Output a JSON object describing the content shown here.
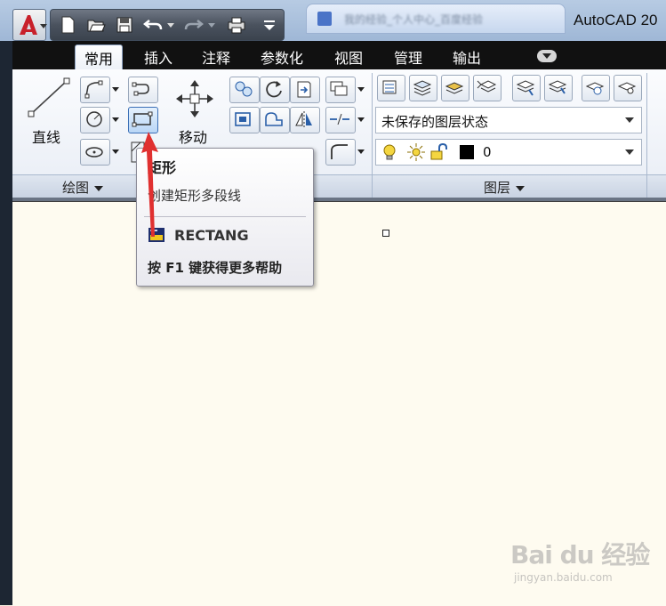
{
  "window": {
    "app_title": "AutoCAD 20",
    "browser_tab_text": "我的经验_个人中心_百度经验"
  },
  "quick_access": {
    "buttons": [
      "new-icon",
      "open-icon",
      "save-icon",
      "undo-icon",
      "redo-icon",
      "plot-icon",
      "customize-dropdown-icon"
    ]
  },
  "ribbon": {
    "tabs": [
      "常用",
      "插入",
      "注释",
      "参数化",
      "视图",
      "管理",
      "输出"
    ],
    "active_tab": "常用",
    "draw_panel": {
      "title": "绘图",
      "line_label": "直线"
    },
    "modify_panel": {
      "move_label": "移动"
    },
    "layers_panel": {
      "title": "图层",
      "layer_state_value": "未保存的图层状态",
      "current_layer": "0"
    }
  },
  "tooltip": {
    "title": "矩形",
    "description": "创建矩形多段线",
    "command": "RECTANG",
    "help_hint": "按 F1 键获得更多帮助"
  },
  "watermark": {
    "text": "Bai du 经验",
    "url": "jingyan.baidu.com"
  },
  "colors": {
    "accent": "#3b6fb6",
    "canvas": "#fefbf0",
    "annotation_arrow": "#e03030"
  }
}
